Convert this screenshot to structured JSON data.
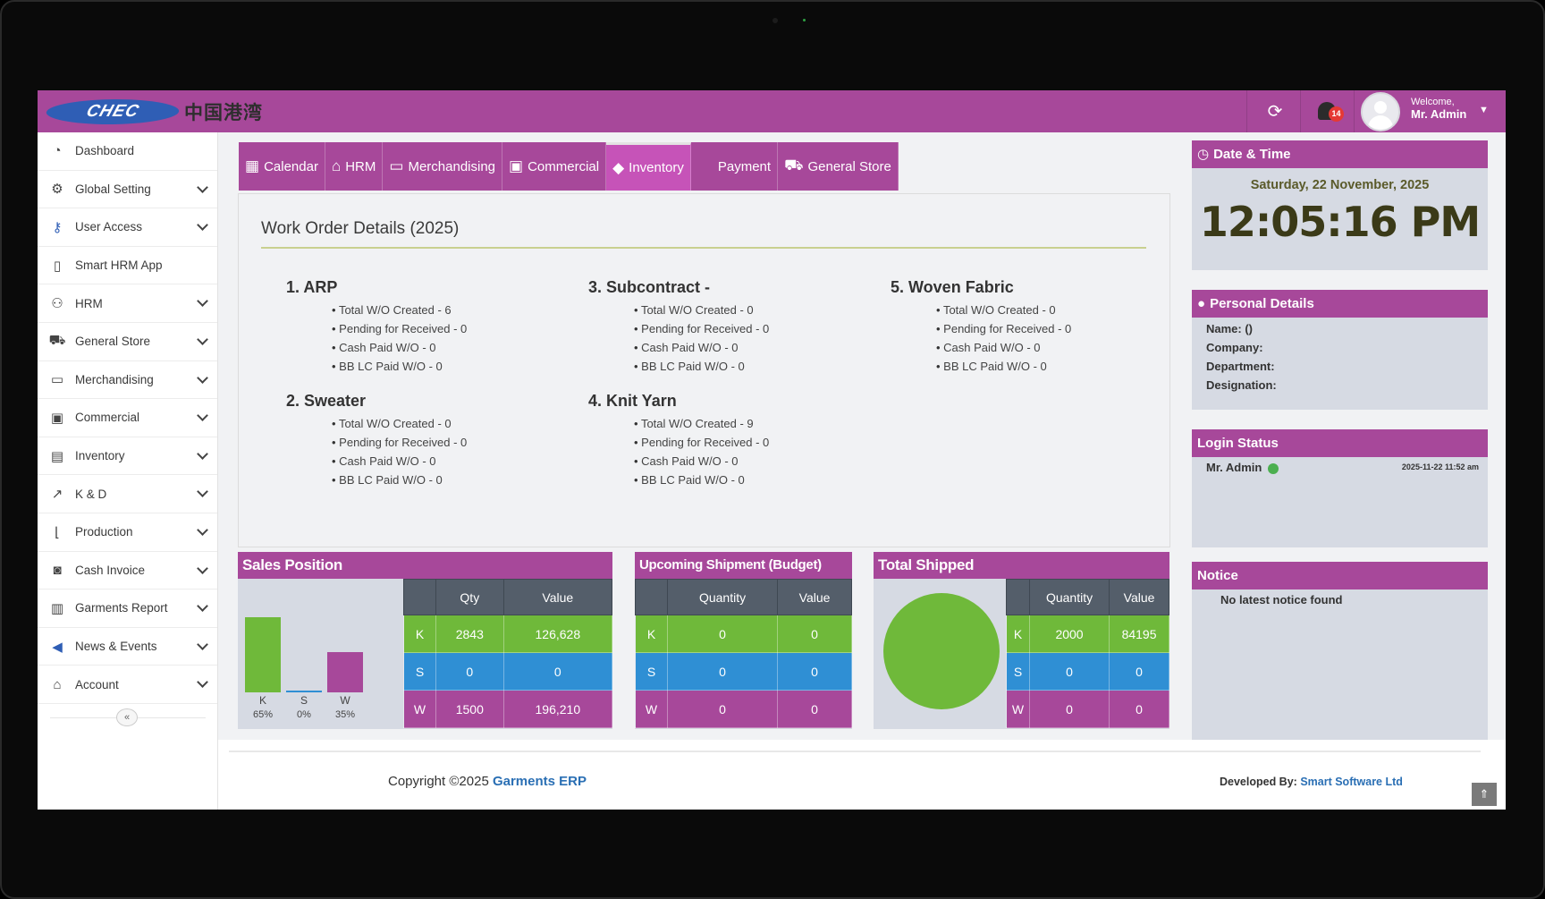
{
  "logo": {
    "mark": "CHEC",
    "cn_text": "中国港湾"
  },
  "topbar": {
    "notification_count": "14",
    "welcome": "Welcome,",
    "user_name": "Mr. Admin"
  },
  "sidebar": {
    "items": [
      {
        "label": "Dashboard"
      },
      {
        "label": "Global Setting"
      },
      {
        "label": "User Access"
      },
      {
        "label": "Smart HRM App"
      },
      {
        "label": "HRM"
      },
      {
        "label": "General Store"
      },
      {
        "label": "Merchandising"
      },
      {
        "label": "Commercial"
      },
      {
        "label": "Inventory"
      },
      {
        "label": "K & D"
      },
      {
        "label": "Production"
      },
      {
        "label": "Cash Invoice"
      },
      {
        "label": "Garments Report"
      },
      {
        "label": "News & Events"
      },
      {
        "label": "Account"
      }
    ],
    "collapse_label": "«"
  },
  "tabs": [
    {
      "label": "Calendar"
    },
    {
      "label": "HRM"
    },
    {
      "label": "Merchandising"
    },
    {
      "label": "Commercial"
    },
    {
      "label": "Inventory"
    },
    {
      "label": "Payment"
    },
    {
      "label": "General Store"
    }
  ],
  "work_orders": {
    "title": "Work Order Details (2025)",
    "sections": [
      {
        "heading": "1. ARP",
        "lines": [
          "Total W/O Created - 6",
          "Pending for Received - 0",
          "Cash Paid W/O - 0",
          "BB LC Paid W/O - 0"
        ]
      },
      {
        "heading": "2. Sweater",
        "lines": [
          "Total W/O Created - 0",
          "Pending for Received - 0",
          "Cash Paid W/O - 0",
          "BB LC Paid W/O - 0"
        ]
      },
      {
        "heading": "3. Subcontract -",
        "lines": [
          "Total W/O Created - 0",
          "Pending for Received - 0",
          "Cash Paid W/O - 0",
          "BB LC Paid W/O - 0"
        ]
      },
      {
        "heading": "4. Knit Yarn",
        "lines": [
          "Total W/O Created - 9",
          "Pending for Received - 0",
          "Cash Paid W/O - 0",
          "BB LC Paid W/O - 0"
        ]
      },
      {
        "heading": "5. Woven Fabric",
        "lines": [
          "Total W/O Created - 0",
          "Pending for Received - 0",
          "Cash Paid W/O - 0",
          "BB LC Paid W/O - 0"
        ]
      }
    ]
  },
  "sales_position": {
    "title": "Sales Position",
    "headers": [
      "",
      "Qty",
      "Value"
    ],
    "rows": [
      {
        "label": "K",
        "qty": "2843",
        "value": "126,628"
      },
      {
        "label": "S",
        "qty": "0",
        "value": "0"
      },
      {
        "label": "W",
        "qty": "1500",
        "value": "196,210"
      }
    ],
    "bars": [
      {
        "label": "K",
        "pct": "65%",
        "color": "#6fb93a"
      },
      {
        "label": "S",
        "pct": "0%",
        "color": "#2f8fd4"
      },
      {
        "label": "W",
        "pct": "35%",
        "color": "#a7489a"
      }
    ]
  },
  "chart_data": {
    "type": "bar",
    "categories": [
      "K",
      "S",
      "W"
    ],
    "values": [
      65,
      0,
      35
    ],
    "ylim": [
      0,
      65
    ]
  },
  "upcoming_shipment": {
    "title": "Upcoming Shipment (Budget)",
    "headers": [
      "",
      "Quantity",
      "Value"
    ],
    "rows": [
      {
        "label": "K",
        "qty": "0",
        "value": "0"
      },
      {
        "label": "S",
        "qty": "0",
        "value": "0"
      },
      {
        "label": "W",
        "qty": "0",
        "value": "0"
      }
    ]
  },
  "total_shipped": {
    "title": "Total Shipped",
    "headers": [
      "",
      "Quantity",
      "Value"
    ],
    "rows": [
      {
        "label": "K",
        "qty": "2000",
        "value": "84195"
      },
      {
        "label": "S",
        "qty": "0",
        "value": "0"
      },
      {
        "label": "W",
        "qty": "0",
        "value": "0"
      }
    ]
  },
  "datetime": {
    "title": "Date & Time",
    "date": "Saturday, 22 November, 2025",
    "time": "12:05:16 PM"
  },
  "personal": {
    "title": "Personal Details",
    "name": "Name: ()",
    "company": "Company:",
    "department": "Department:",
    "designation": "Designation:"
  },
  "login_status": {
    "title": "Login Status",
    "user": "Mr. Admin",
    "time": "2025-11-22 11:52 am"
  },
  "notice": {
    "title": "Notice",
    "text": "No latest notice found"
  },
  "footer": {
    "copyright": "Copyright ©2025 ",
    "copyright_link": "Garments ERP",
    "dev_label": "Developed By: ",
    "dev_link": "Smart Software Ltd"
  },
  "colors": {
    "brand": "#a7489a",
    "k": "#6fb93a",
    "s": "#2f8fd4",
    "w": "#a7489a"
  }
}
